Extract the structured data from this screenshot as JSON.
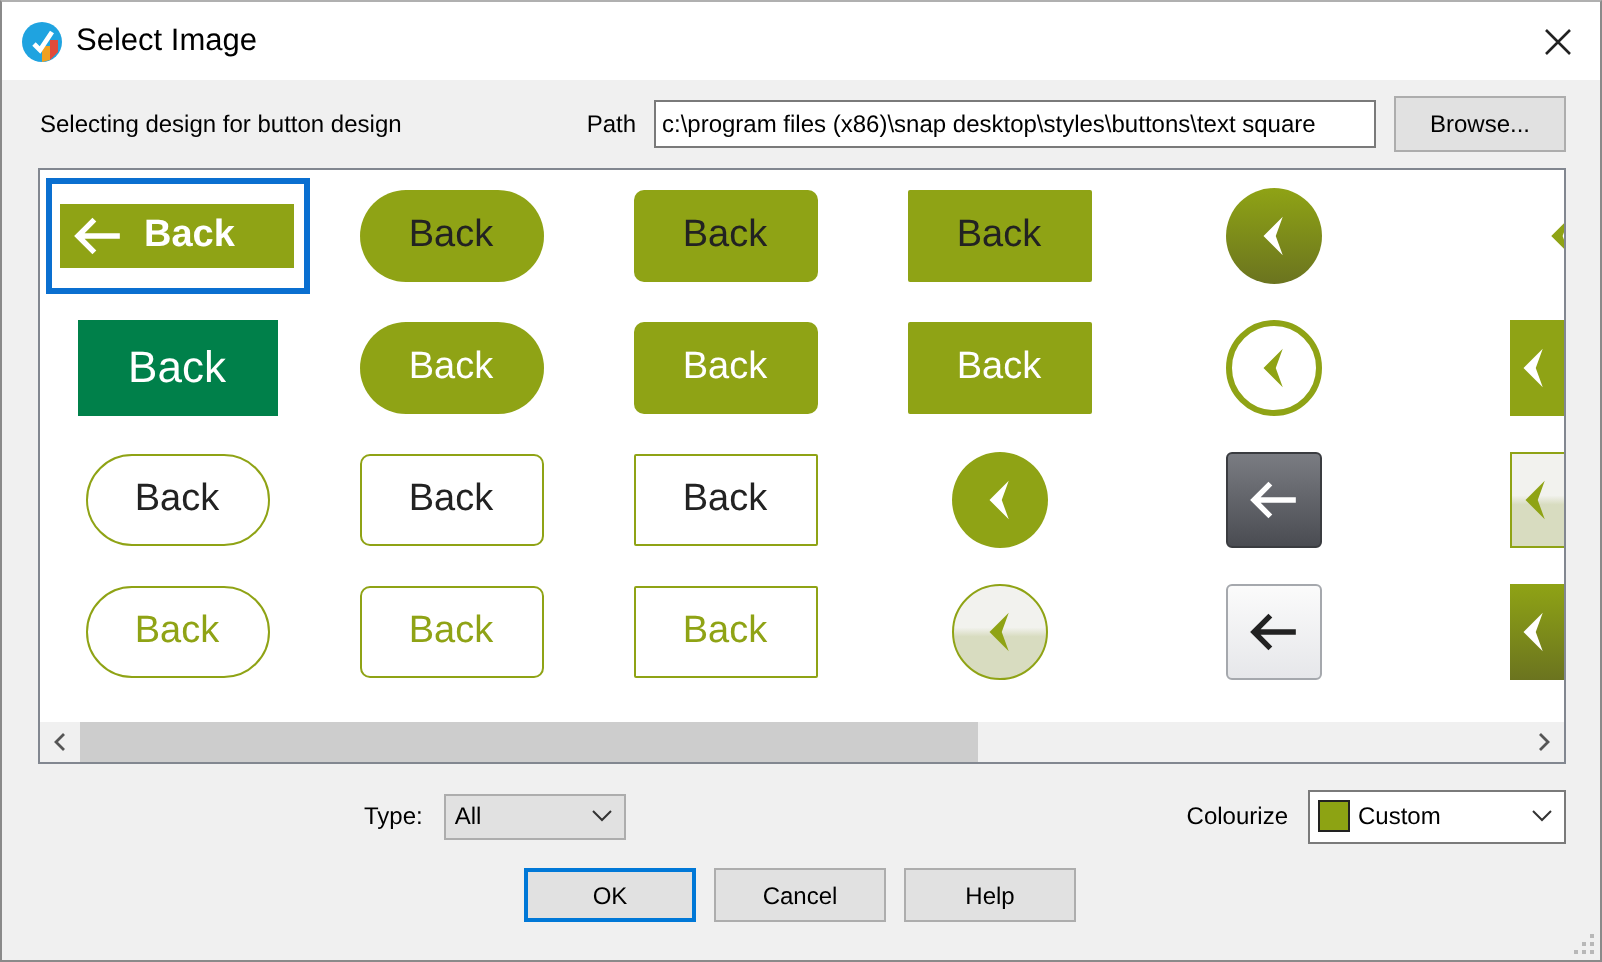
{
  "window": {
    "title": "Select Image"
  },
  "header": {
    "caption": "Selecting design for button design",
    "path_label": "Path",
    "path": "c:\\program files (x86)\\snap desktop\\styles\\buttons\\text square",
    "browse": "Browse..."
  },
  "designs": [
    {
      "kind": "banner",
      "label": "Back",
      "selected": true
    },
    {
      "kind": "pillsolid",
      "label": "Back",
      "selected": false
    },
    {
      "kind": "roundedsolid",
      "label": "Back",
      "selected": false
    },
    {
      "kind": "squaresolid",
      "label": "Back",
      "selected": false
    },
    {
      "kind": "orbshaded",
      "selected": false
    },
    {
      "kind": "edgebare",
      "selected": false
    },
    {
      "kind": "block",
      "label": "Back",
      "selected": false
    },
    {
      "kind": "pillinverse",
      "label": "Back",
      "selected": false
    },
    {
      "kind": "roundedinverse",
      "label": "Back",
      "selected": false
    },
    {
      "kind": "squareinverse",
      "label": "Back",
      "selected": false
    },
    {
      "kind": "ringed",
      "selected": false
    },
    {
      "kind": "edgesolid",
      "selected": false
    },
    {
      "kind": "pilloutline",
      "label": "Back",
      "selected": false
    },
    {
      "kind": "roundedoutline",
      "label": "Back",
      "selected": false
    },
    {
      "kind": "squareoutline",
      "label": "Back",
      "selected": false
    },
    {
      "kind": "orb",
      "selected": false
    },
    {
      "kind": "tiledark",
      "selected": false
    },
    {
      "kind": "edgelight",
      "selected": false
    },
    {
      "kind": "pilltinted",
      "label": "Back",
      "selected": false
    },
    {
      "kind": "roundedtinted",
      "label": "Back",
      "selected": false
    },
    {
      "kind": "squaretinted",
      "label": "Back",
      "selected": false
    },
    {
      "kind": "orblight",
      "selected": false
    },
    {
      "kind": "tilelight",
      "selected": false
    },
    {
      "kind": "edgeshaded",
      "selected": false
    }
  ],
  "type": {
    "label": "Type:",
    "value": "All"
  },
  "colourize": {
    "label": "Colourize",
    "value": "Custom"
  },
  "buttons": [
    {
      "label": "OK",
      "default": true
    },
    {
      "label": "Cancel",
      "default": false
    },
    {
      "label": "Help",
      "default": false
    }
  ]
}
